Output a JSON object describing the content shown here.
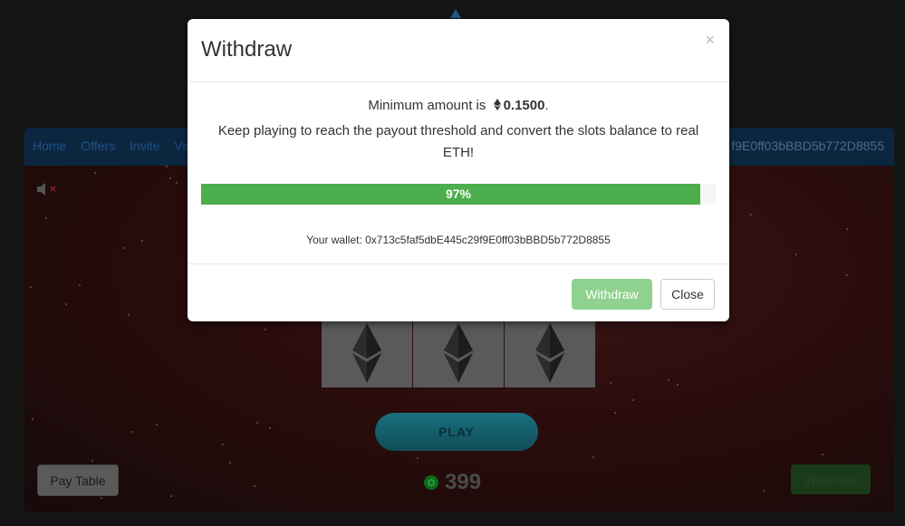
{
  "nav": {
    "links": [
      "Home",
      "Offers",
      "Invite",
      "Vis"
    ],
    "wallet_fragment": "f9E0ff03bBBD5b772D8855"
  },
  "game": {
    "play_label": "PLAY",
    "pay_table_label": "Pay Table",
    "balance": "399",
    "withdraw_label": "Withdraw",
    "reels": [
      "ethereum-icon",
      "ethereum-icon",
      "ethereum-icon"
    ]
  },
  "modal": {
    "title": "Withdraw",
    "close_symbol": "×",
    "min_text": "Minimum amount is",
    "min_amount": "0.1500",
    "min_suffix": ".",
    "message": "Keep playing to reach the payout threshold and convert the slots balance to real ETH!",
    "progress_value": 0.97,
    "progress_label": "97%",
    "wallet_text": "Your wallet: 0x713c5faf5dbE445c29f9E0ff03bBBD5b772D8855",
    "withdraw_button": "Withdraw",
    "close_button": "Close"
  },
  "colors": {
    "progress": "#4cae4c",
    "withdraw_disabled": "#8fd18f"
  }
}
